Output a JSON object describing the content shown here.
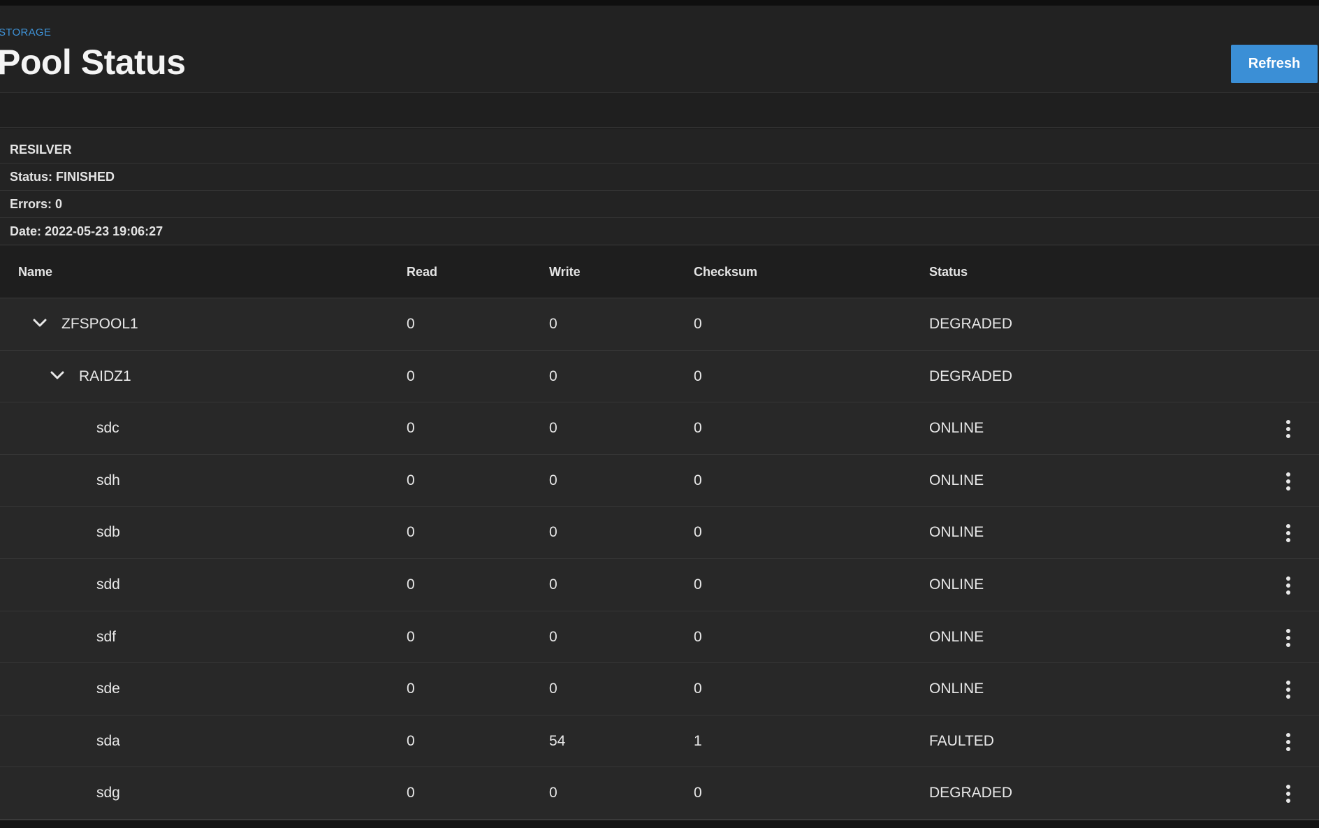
{
  "header": {
    "breadcrumb": "STORAGE",
    "title": "Pool Status",
    "refresh_label": "Refresh"
  },
  "scan": {
    "title": "RESILVER",
    "status": "Status: FINISHED",
    "errors": "Errors: 0",
    "date": "Date: 2022-05-23 19:06:27"
  },
  "table": {
    "columns": [
      "Name",
      "Read",
      "Write",
      "Checksum",
      "Status"
    ],
    "rows": [
      {
        "name": "ZFSPOOL1",
        "read": "0",
        "write": "0",
        "checksum": "0",
        "status": "DEGRADED",
        "level": 0,
        "expandable": true,
        "menu": false
      },
      {
        "name": "RAIDZ1",
        "read": "0",
        "write": "0",
        "checksum": "0",
        "status": "DEGRADED",
        "level": 1,
        "expandable": true,
        "menu": false
      },
      {
        "name": "sdc",
        "read": "0",
        "write": "0",
        "checksum": "0",
        "status": "ONLINE",
        "level": 2,
        "expandable": false,
        "menu": true
      },
      {
        "name": "sdh",
        "read": "0",
        "write": "0",
        "checksum": "0",
        "status": "ONLINE",
        "level": 2,
        "expandable": false,
        "menu": true
      },
      {
        "name": "sdb",
        "read": "0",
        "write": "0",
        "checksum": "0",
        "status": "ONLINE",
        "level": 2,
        "expandable": false,
        "menu": true
      },
      {
        "name": "sdd",
        "read": "0",
        "write": "0",
        "checksum": "0",
        "status": "ONLINE",
        "level": 2,
        "expandable": false,
        "menu": true
      },
      {
        "name": "sdf",
        "read": "0",
        "write": "0",
        "checksum": "0",
        "status": "ONLINE",
        "level": 2,
        "expandable": false,
        "menu": true
      },
      {
        "name": "sde",
        "read": "0",
        "write": "0",
        "checksum": "0",
        "status": "ONLINE",
        "level": 2,
        "expandable": false,
        "menu": true
      },
      {
        "name": "sda",
        "read": "0",
        "write": "54",
        "checksum": "1",
        "status": "FAULTED",
        "level": 2,
        "expandable": false,
        "menu": true
      },
      {
        "name": "sdg",
        "read": "0",
        "write": "0",
        "checksum": "0",
        "status": "DEGRADED",
        "level": 2,
        "expandable": false,
        "menu": true
      }
    ]
  },
  "icons": {
    "expand": "chevron-down-icon",
    "row_menu": "more-vert-icon"
  },
  "colors": {
    "accent": "#3b8fd6",
    "background": "#1c1c1c",
    "row": "#282828"
  }
}
